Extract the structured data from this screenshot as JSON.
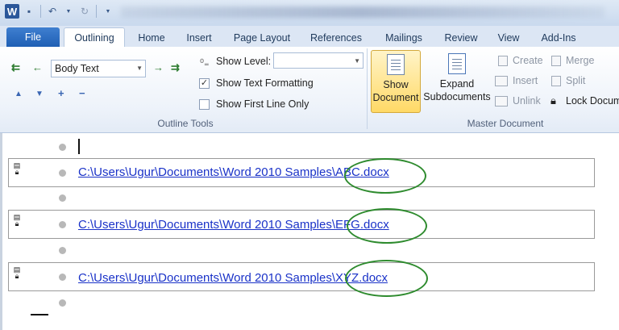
{
  "qat": {
    "logo": "W",
    "icons": [
      "save-icon",
      "undo-icon",
      "redo-icon",
      "customize-icon"
    ]
  },
  "tabs": {
    "file": "File",
    "outlining": "Outlining",
    "home": "Home",
    "insert": "Insert",
    "page_layout": "Page Layout",
    "references": "References",
    "mailings": "Mailings",
    "review": "Review",
    "view": "View",
    "addins": "Add-Ins"
  },
  "outline_tools": {
    "level_value": "Body Text",
    "show_level_label": "Show Level:",
    "show_level_value": "",
    "show_text_formatting_label": "Show Text Formatting",
    "show_text_formatting_checked": true,
    "show_first_line_label": "Show First Line Only",
    "show_first_line_checked": false,
    "group_label": "Outline Tools"
  },
  "master_document": {
    "show_document_line1": "Show",
    "show_document_line2": "Document",
    "expand_line1": "Expand",
    "expand_line2": "Subdocuments",
    "create": "Create",
    "merge": "Merge",
    "insert": "Insert",
    "split": "Split",
    "unlink": "Unlink",
    "lock_document": "Lock Docum",
    "group_label": "Master Document"
  },
  "document": {
    "subdocuments": [
      {
        "path": "C:\\Users\\Ugur\\Documents\\Word 2010 Samples\\ABC.docx"
      },
      {
        "path": "C:\\Users\\Ugur\\Documents\\Word 2010 Samples\\EFG.docx"
      },
      {
        "path": "C:\\Users\\Ugur\\Documents\\Word 2010 Samples\\XYZ.docx"
      }
    ]
  },
  "colors": {
    "accent": "#2b579a",
    "link": "#1a32c8",
    "annotation": "#2e8b2e",
    "highlight": "#ffd966"
  }
}
